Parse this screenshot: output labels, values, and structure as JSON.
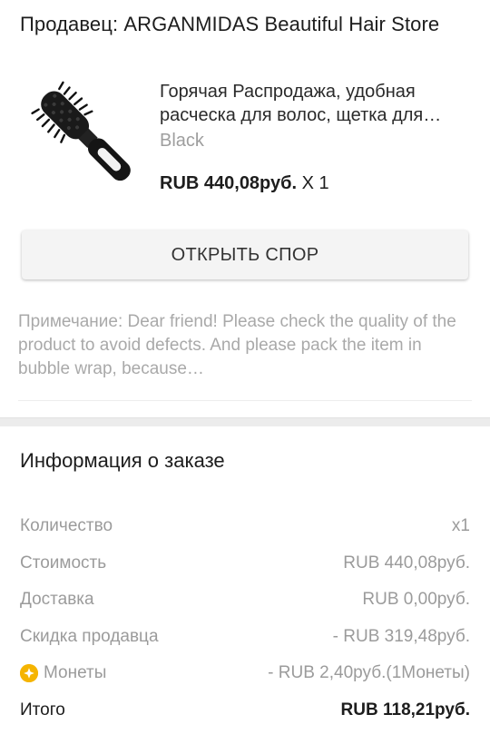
{
  "seller": {
    "text": "Продавец: ARGANMIDAS Beautiful Hair Store"
  },
  "product": {
    "title": "Горячая Распродажа, удобная расческа для волос, щетка для…",
    "variant": "Black",
    "price": "RUB 440,08руб.",
    "quantity": " X 1",
    "thumbnail_icon": "hairbrush-icon"
  },
  "dispute_button": {
    "label": "ОТКРЫТЬ СПОР"
  },
  "note": {
    "label": "Примечание: ",
    "text": "Dear friend! Please check the quality of the product to avoid defects. And please pack the item in bubble wrap, because…"
  },
  "order_info": {
    "title": "Информация о заказе",
    "rows": [
      {
        "label": "Количество",
        "value": "x1"
      },
      {
        "label": "Стоимость",
        "value": "RUB 440,08руб."
      },
      {
        "label": "Доставка",
        "value": "RUB 0,00руб."
      },
      {
        "label": "Скидка продавца",
        "value": "- RUB 319,48руб."
      },
      {
        "label": "Монеты",
        "value": "- RUB 2,40руб.(1Монеты)",
        "icon": "coin-icon"
      },
      {
        "label": "Итого",
        "value": "RUB 118,21руб."
      }
    ]
  },
  "colors": {
    "coin": "#f5b400",
    "muted_text": "#9b9b9b",
    "button_bg": "#f4f4f4"
  }
}
